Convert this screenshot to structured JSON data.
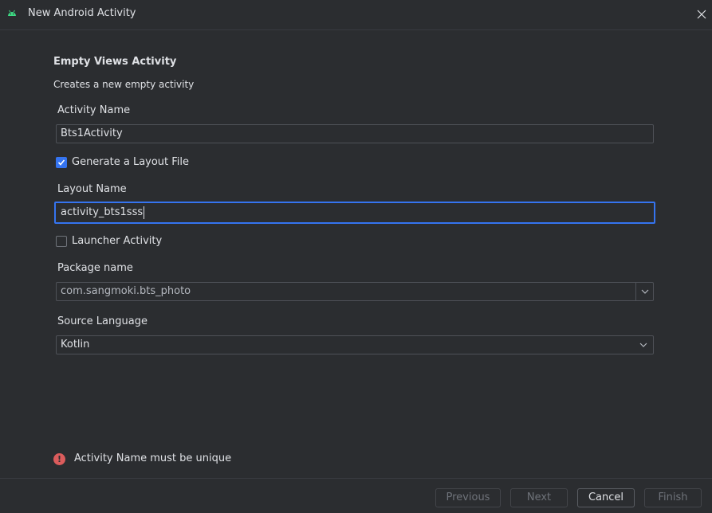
{
  "window": {
    "title": "New Android Activity",
    "icon": "android-icon",
    "close_icon": "close-icon"
  },
  "template": {
    "heading": "Empty Views Activity",
    "description": "Creates a new empty activity"
  },
  "form": {
    "activity_name": {
      "label": "Activity Name",
      "value": "Bts1Activity"
    },
    "generate_layout": {
      "label": "Generate a Layout File",
      "checked": true
    },
    "layout_name": {
      "label": "Layout Name",
      "value": "activity_bts1sss"
    },
    "launcher_activity": {
      "label": "Launcher Activity",
      "checked": false
    },
    "package_name": {
      "label": "Package name",
      "value": "com.sangmoki.bts_photo"
    },
    "source_language": {
      "label": "Source Language",
      "value": "Kotlin"
    }
  },
  "validation": {
    "icon": "error-icon",
    "message": "Activity Name must be unique"
  },
  "buttons": {
    "previous": "Previous",
    "next": "Next",
    "cancel": "Cancel",
    "finish": "Finish"
  },
  "colors": {
    "background": "#2b2d30",
    "accent": "#3574f0",
    "error": "#db5c5c",
    "android_green": "#3ddc84"
  }
}
